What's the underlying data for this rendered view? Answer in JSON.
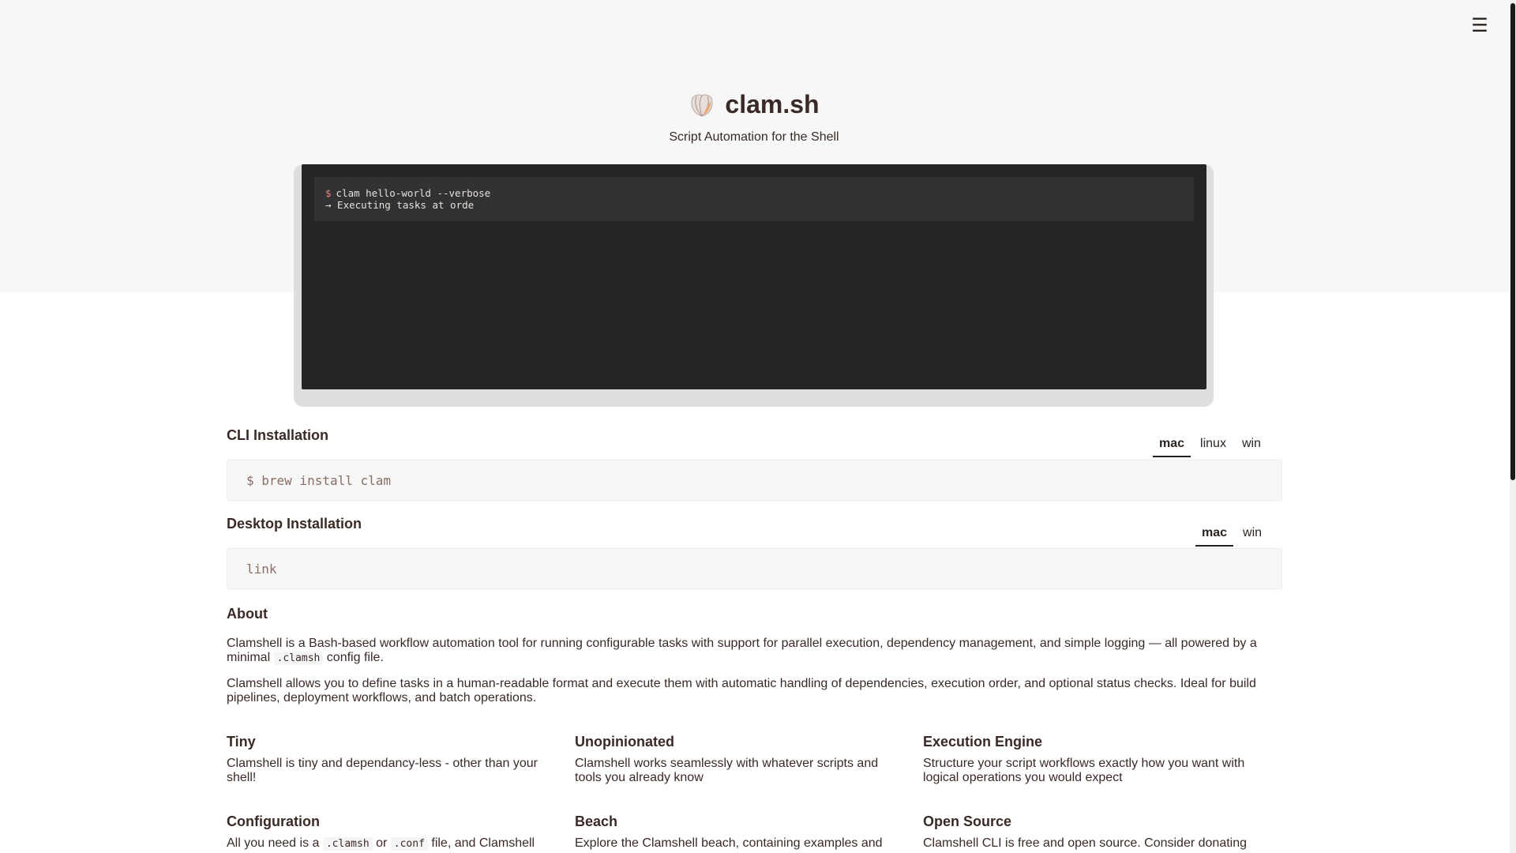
{
  "header": {
    "menu_icon": "hamburger-menu-icon",
    "logo_icon": "clam-shell-icon",
    "title": "clam.sh",
    "tagline": "Script Automation for the Shell"
  },
  "terminal": {
    "prompt": "$",
    "command": "clam hello-world --verbose",
    "output": "→ Executing tasks at orde"
  },
  "cli_install": {
    "title": "CLI Installation",
    "tabs": [
      "mac",
      "linux",
      "win"
    ],
    "active_tab": "mac",
    "command": "$ brew install clam"
  },
  "desktop_install": {
    "title": "Desktop Installation",
    "tabs": [
      "mac",
      "win"
    ],
    "active_tab": "mac",
    "content": "link"
  },
  "about": {
    "title": "About",
    "p1_before": "Clamshell is a Bash-based workflow automation tool for running configurable tasks with support for parallel execution, dependency management, and simple logging — all powered by a minimal ",
    "p1_code": ".clamsh",
    "p1_after": " config file.",
    "p2": "Clamshell allows you to define tasks in a human-readable format and execute them with automatic handling of dependencies, execution order, and optional status checks. Ideal for build pipelines, deployment workflows, and batch operations."
  },
  "features": {
    "tiny": {
      "title": "Tiny",
      "text": "Clamshell is tiny and dependancy-less - other than your shell!"
    },
    "unopinionated": {
      "title": "Unopinionated",
      "text": "Clamshell works seamlessly with whatever scripts and tools you already know"
    },
    "engine": {
      "title": "Execution Engine",
      "text": "Structure your script workflows exactly how you want with logical operations you would expect"
    },
    "configuration": {
      "title": "Configuration",
      "text_before": "All you need is a ",
      "code1": ".clamsh",
      "text_mid": " or ",
      "code2": ".conf",
      "text_after": " file, and Clamshell"
    },
    "beach": {
      "title": "Beach",
      "text": "Explore the Clamshell beach, containing examples and"
    },
    "open_source": {
      "title": "Open Source",
      "text": "Clamshell CLI is free and open source. Consider donating"
    }
  }
}
